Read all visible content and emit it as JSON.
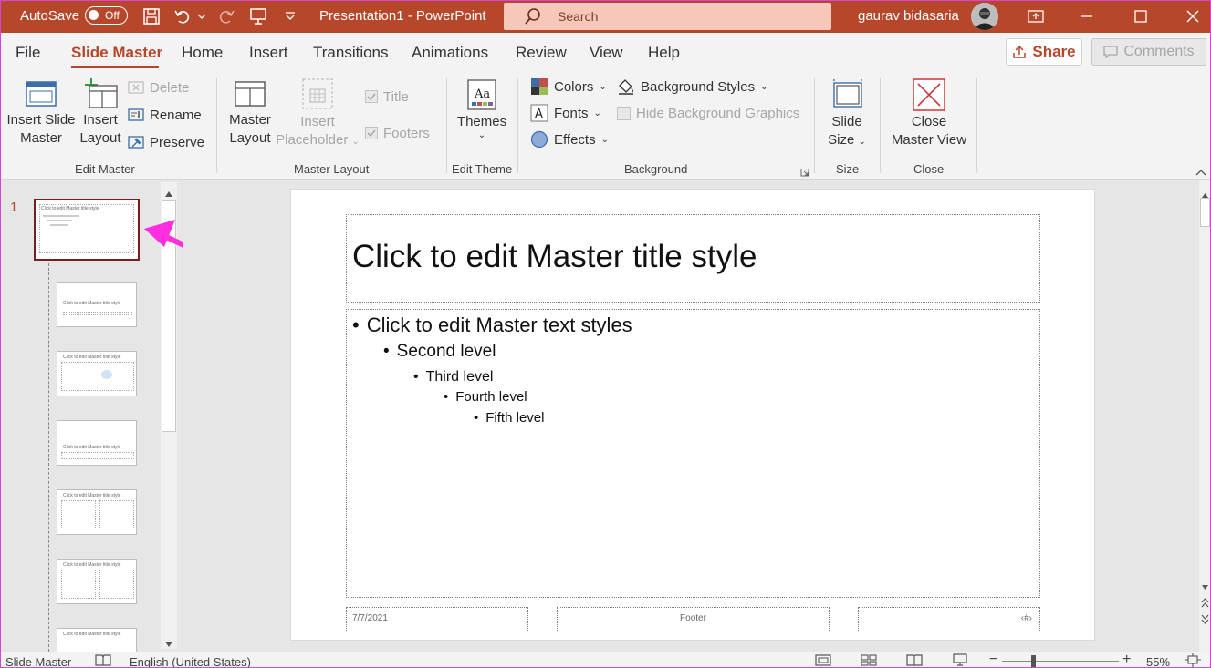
{
  "titlebar": {
    "autosave_label": "AutoSave",
    "autosave_state": "Off",
    "doc_title": "Presentation1 - PowerPoint",
    "search_placeholder": "Search",
    "user_name": "gaurav bidasaria",
    "accent_color": "#b7472a"
  },
  "tabs": {
    "items": [
      "File",
      "Slide Master",
      "Home",
      "Insert",
      "Transitions",
      "Animations",
      "Review",
      "View",
      "Help"
    ],
    "active": "Slide Master",
    "share_label": "Share",
    "comments_label": "Comments"
  },
  "ribbon": {
    "edit_master": {
      "label": "Edit Master",
      "insert_slide_master": [
        "Insert Slide",
        "Master"
      ],
      "insert_layout": [
        "Insert",
        "Layout"
      ],
      "delete": "Delete",
      "rename": "Rename",
      "preserve": "Preserve"
    },
    "master_layout": {
      "label": "Master Layout",
      "master_layout": [
        "Master",
        "Layout"
      ],
      "insert_placeholder": [
        "Insert",
        "Placeholder"
      ],
      "title": "Title",
      "footers": "Footers"
    },
    "edit_theme": {
      "label": "Edit Theme",
      "themes": "Themes"
    },
    "background": {
      "label": "Background",
      "colors": "Colors",
      "fonts": "Fonts",
      "effects": "Effects",
      "background_styles": "Background Styles",
      "hide_background_graphics": "Hide Background Graphics"
    },
    "size": {
      "label": "Size",
      "slide_size": [
        "Slide",
        "Size"
      ]
    },
    "close": {
      "label": "Close",
      "close_master_view": [
        "Close",
        "Master View"
      ]
    }
  },
  "thumbnails": {
    "master_number": "1",
    "master_thumb_title": "Click to edit Master title style",
    "layout_thumb_title": "Click to edit Master title style"
  },
  "slide": {
    "title": "Click to edit Master title style",
    "levels": [
      "Click to edit Master text styles",
      "Second level",
      "Third level",
      "Fourth level",
      "Fifth level"
    ],
    "date": "7/7/2021",
    "footer": "Footer",
    "slide_number": "‹#›"
  },
  "statusbar": {
    "view": "Slide Master",
    "language": "English (United States)",
    "zoom": "55%"
  }
}
